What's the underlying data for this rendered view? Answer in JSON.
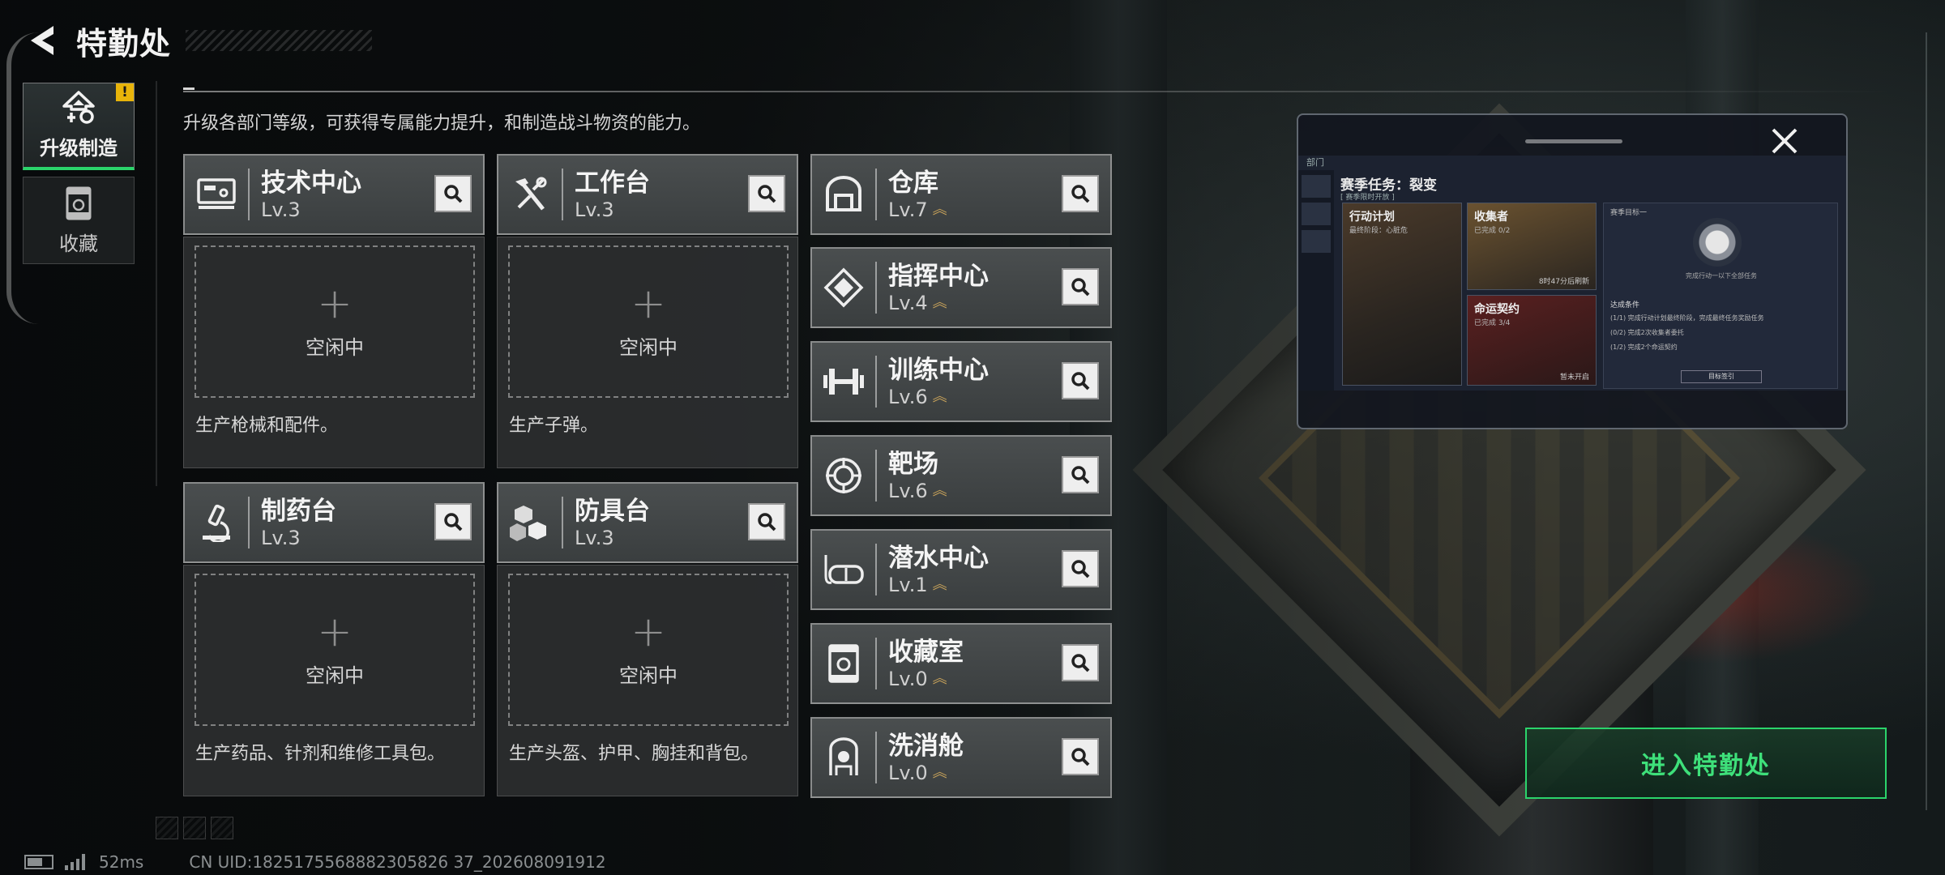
{
  "header": {
    "title": "特勤处"
  },
  "nav": {
    "tabs": [
      {
        "label": "升级制造",
        "active": true,
        "warning": "!"
      },
      {
        "label": "收藏",
        "active": false
      }
    ]
  },
  "description": "升级各部门等级，可获得专属能力提升，和制造战斗物资的能力。",
  "production_cards": [
    {
      "name": "技术中心",
      "level": "Lv.3",
      "icon": "computer-icon",
      "slot_status": "空闲中",
      "desc": "生产枪械和配件。"
    },
    {
      "name": "工作台",
      "level": "Lv.3",
      "icon": "tools-icon",
      "slot_status": "空闲中",
      "desc": "生产子弹。"
    },
    {
      "name": "制药台",
      "level": "Lv.3",
      "icon": "microscope-icon",
      "slot_status": "空闲中",
      "desc": "生产药品、针剂和维修工具包。"
    },
    {
      "name": "防具台",
      "level": "Lv.3",
      "icon": "armor-blocks-icon",
      "slot_status": "空闲中",
      "desc": "生产头盔、护甲、胸挂和背包。"
    }
  ],
  "upgrade_departments": [
    {
      "name": "仓库",
      "level": "Lv.7",
      "icon": "warehouse-icon"
    },
    {
      "name": "指挥中心",
      "level": "Lv.4",
      "icon": "command-icon"
    },
    {
      "name": "训练中心",
      "level": "Lv.6",
      "icon": "dumbbell-icon"
    },
    {
      "name": "靶场",
      "level": "Lv.6",
      "icon": "target-icon"
    },
    {
      "name": "潜水中心",
      "level": "Lv.1",
      "icon": "diving-mask-icon"
    },
    {
      "name": "收藏室",
      "level": "Lv.0",
      "icon": "collection-icon"
    },
    {
      "name": "洗消舱",
      "level": "Lv.0",
      "icon": "hazmat-icon"
    }
  ],
  "preview": {
    "breadcrumb": "部门",
    "title": "赛季任务：裂变",
    "subtitle": "[ 赛季限时开放 ]",
    "tiles": [
      {
        "title": "行动计划",
        "sub": "最终阶段：心脏危"
      },
      {
        "title": "收集者",
        "sub": "已完成 0/2",
        "foot": "8时47分后刷新"
      },
      {
        "title": "命运契约",
        "sub": "已完成 3/4",
        "foot": "暂未开启"
      }
    ],
    "goal_header": "赛季目标一",
    "goal_caption": "完成行动一以下全部任务",
    "conditions_title": "达成条件",
    "conditions": [
      "(1/1) 完成行动计划最终阶段，完成最终任务奖励任务",
      "(0/2) 完成2次收集者委托",
      "(1/2) 完成2个命运契约"
    ],
    "goal_button": "目标签引"
  },
  "enter_button": "进入特勤处",
  "footer": {
    "ping": "52ms",
    "uid": "CN UID:1825175568882305826 37_202608091912"
  },
  "colors": {
    "accent_green": "#2bd46b",
    "warning_yellow": "#e8b40a",
    "level_chevron": "#c9a35a"
  }
}
